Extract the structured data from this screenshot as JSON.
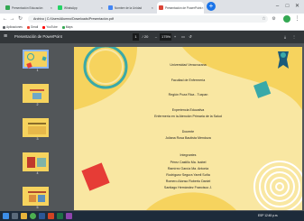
{
  "browser": {
    "tabs": [
      {
        "label": "Presentación Educación",
        "color": "#34a853"
      },
      {
        "label": "WhatsApp",
        "color": "#25d366"
      },
      {
        "label": "Nombre de la Unidad",
        "color": "#4285f4"
      },
      {
        "label": "Presentación de PowerPoint",
        "color": "#db4437"
      }
    ],
    "new_tab": "+",
    "window_controls": [
      "–",
      "□",
      "✕"
    ],
    "address": "Archivo | C:/Users/Alumno/Downloads/Presentación.pdf",
    "bookmarks": [
      "Aplicaciones",
      "Gmail",
      "YouTube",
      "Maps"
    ]
  },
  "pdf": {
    "title": "Presentación de PowerPoint",
    "page_current": "1",
    "page_total": "/ 20",
    "zoom": "175%",
    "minus": "–",
    "plus": "+",
    "fit_icon": "fit-page-icon",
    "rotate_icon": "rotate-icon",
    "download_icon": "download-icon",
    "print_icon": "print-icon",
    "more_icon": "more-icon"
  },
  "thumbnails": [
    {
      "page": "1"
    },
    {
      "page": "2"
    },
    {
      "page": "3"
    },
    {
      "page": "4"
    },
    {
      "page": "5"
    }
  ],
  "slide": {
    "lines": [
      "Universidad Veracruzana",
      "Facultad de Enfermería",
      "Región Poza Rica - Tuxpan",
      "Experiencia Educativa",
      "Enfermería en la Atención Primaria de la Salud",
      "Docente",
      "Juliana Rosa Bautista Mendoza",
      "Integrantes",
      "Pérez Castillo Ma. Isabel",
      "Ramírez García Ma. Antonia",
      "Rodríguez Segura Yareli Sofía",
      "Romero Alonso Roberto Daniel",
      "Santiago Hernández Francisco J."
    ],
    "colors": {
      "background": "#f6d35e",
      "wave": "#f9e7a2",
      "teal": "#3aa9a8",
      "red": "#e63c36",
      "logo": "#1b5b7a"
    }
  },
  "taskbar": {
    "tray": "ESP  12:45 p.m.",
    "icons": [
      "start-icon",
      "search-icon",
      "explorer-icon",
      "chrome-icon",
      "word-icon",
      "powerpoint-icon",
      "excel-icon",
      "media-icon"
    ]
  }
}
